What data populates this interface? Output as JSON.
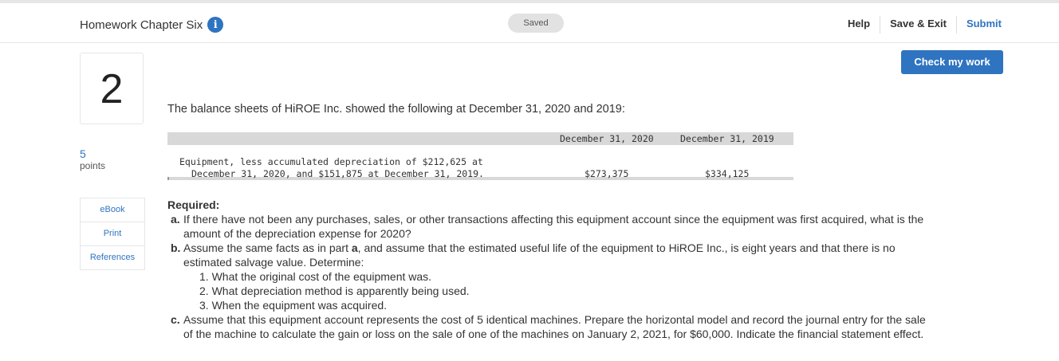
{
  "header": {
    "title": "Homework Chapter Six",
    "info_glyph": "i",
    "saved": "Saved",
    "help": "Help",
    "save_exit": "Save & Exit",
    "submit": "Submit"
  },
  "check_button": "Check my work",
  "question": {
    "number": "2",
    "points_value": "5",
    "points_label": "points"
  },
  "side_links": [
    "eBook",
    "Print",
    "References"
  ],
  "intro": "The balance sheets of HiROE Inc. showed the following at December 31, 2020 and 2019:",
  "table": {
    "col1": "December 31, 2020",
    "col2": "December 31, 2019",
    "row_desc_line1": "Equipment, less accumulated depreciation of $212,625 at",
    "row_desc_line2": "December 31, 2020, and $151,875 at December 31, 2019.",
    "val1": "$273,375",
    "val2": "$334,125"
  },
  "required": {
    "heading": "Required:",
    "a_letter": "a.",
    "a_text": "If there have not been any purchases, sales, or other transactions affecting this equipment account since the equipment was first acquired, what is the amount of the depreciation expense for 2020?",
    "b_letter": "b.",
    "b_text_pre": "Assume the same facts as in part ",
    "b_text_bold": "a",
    "b_text_post": ", and assume that the estimated useful life of the equipment to HiROE Inc., is eight years and that there is no estimated salvage value. Determine:",
    "b_items": [
      "1. What the original cost of the equipment was.",
      "2. What depreciation method is apparently being used.",
      "3. When the equipment was acquired."
    ],
    "c_letter": "c.",
    "c_text": "Assume that this equipment account represents the cost of 5 identical machines. Prepare the horizontal model and record the journal entry for the sale of the machine to calculate the gain or loss on the sale of one of the machines on January 2, 2021, for $60,000. Indicate the financial statement effect."
  },
  "colors": {
    "accent": "#2f74c0",
    "saved_pill": "#e2e2e2",
    "table_header": "#d8d8d8"
  }
}
